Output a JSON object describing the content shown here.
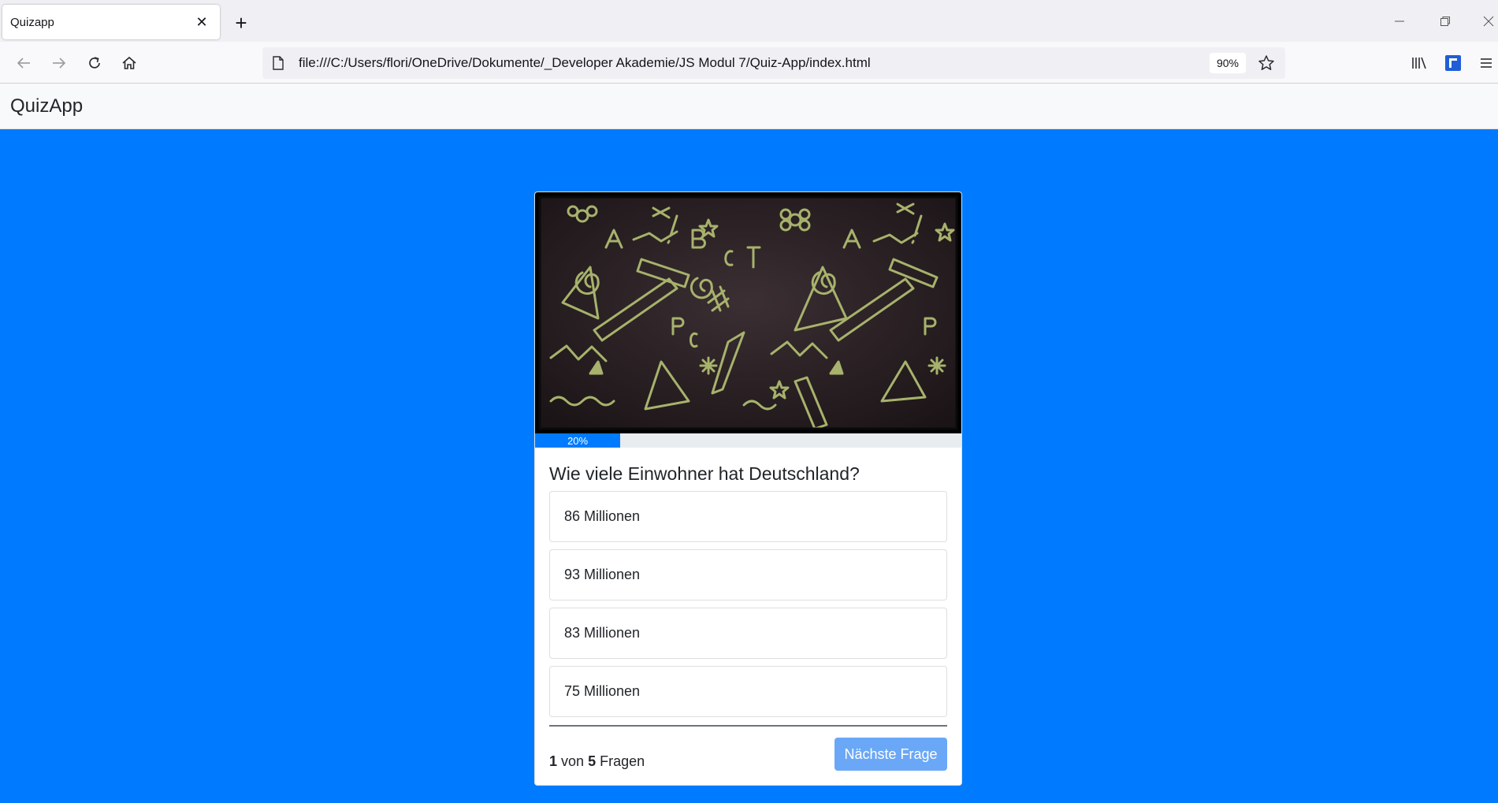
{
  "browser": {
    "tab_title": "Quizapp",
    "url": "file:///C:/Users/flori/OneDrive/Dokumente/_Developer Akademie/JS Modul 7/Quiz-App/index.html",
    "zoom": "90%"
  },
  "app": {
    "brand": "QuizApp",
    "progress_label": "20%",
    "progress_value": 0.2,
    "question": "Wie viele Einwohner hat Deutschland?",
    "answers": [
      {
        "label": "86 Millionen"
      },
      {
        "label": "93 Millionen"
      },
      {
        "label": "83 Millionen"
      },
      {
        "label": "75 Millionen"
      }
    ],
    "counter": {
      "current": "1",
      "separator": "von",
      "total": "5",
      "suffix": "Fragen"
    },
    "next_button": "Nächste Frage"
  },
  "colors": {
    "background": "#007bff",
    "chalk": "#a7b26c",
    "button": "#6aa8f7"
  }
}
